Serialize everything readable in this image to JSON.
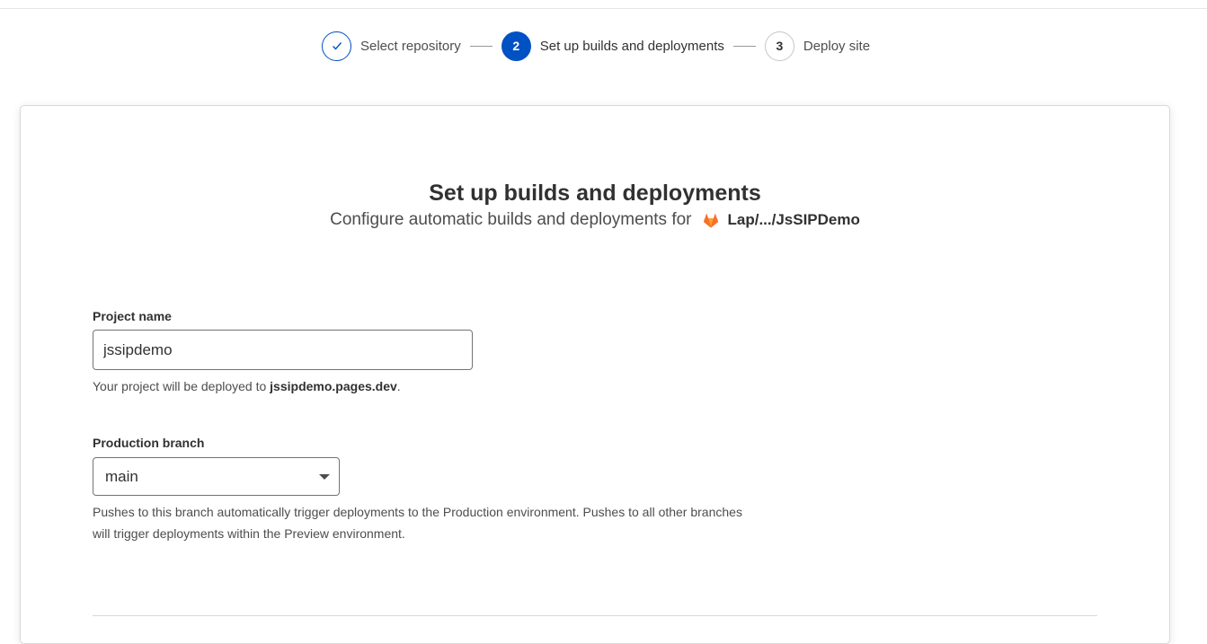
{
  "stepper": {
    "steps": [
      {
        "number": "",
        "label": "Select repository",
        "state": "done",
        "icon": "check-icon"
      },
      {
        "number": "2",
        "label": "Set up builds and deployments",
        "state": "active"
      },
      {
        "number": "3",
        "label": "Deploy site",
        "state": "pending"
      }
    ]
  },
  "card": {
    "title": "Set up builds and deployments",
    "subtitle": "Configure automatic builds and deployments for",
    "repo_icon": "gitlab-icon",
    "repo_name": "Lap/.../JsSIPDemo"
  },
  "project_name": {
    "label": "Project name",
    "value": "jssipdemo",
    "help_prefix": "Your project will be deployed to ",
    "help_domain": "jssipdemo.pages.dev",
    "help_suffix": "."
  },
  "production_branch": {
    "label": "Production branch",
    "selected": "main",
    "help_line1": "Pushes to this branch automatically trigger deployments to the Production environment. Pushes to all other branches",
    "help_line2": "will trigger deployments within the Preview environment."
  },
  "colors": {
    "accent": "#0051c3",
    "gitlab_orange": "#e24329"
  }
}
